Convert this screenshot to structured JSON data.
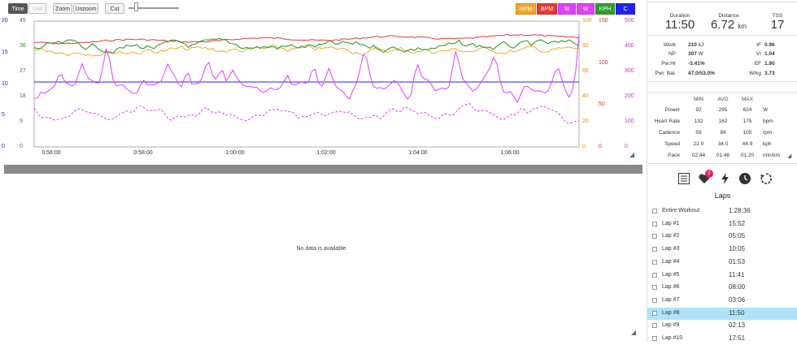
{
  "toolbar": {
    "time": "Time",
    "dist": "Dist",
    "zoom": "Zoom",
    "unzoom": "Unzoom",
    "cut": "Cut"
  },
  "legend": [
    {
      "label": "RPM",
      "color": "#f5a623"
    },
    {
      "label": "BPM",
      "color": "#e53935"
    },
    {
      "label": "W",
      "color": "#e040fb"
    },
    {
      "label": "W",
      "color": "#e040fb"
    },
    {
      "label": "KPH",
      "color": "#2e9e2e"
    },
    {
      "label": "C",
      "color": "#2222ee"
    }
  ],
  "axes": {
    "left_blue": [
      "20",
      "15",
      "10",
      "5",
      "0"
    ],
    "left_green": [
      "45",
      "36",
      "27",
      "18",
      "9",
      "0"
    ],
    "right_orange": [
      "100",
      "80",
      "60",
      "40",
      "20",
      "0"
    ],
    "right_red": [
      "150",
      "100",
      "50",
      "0"
    ],
    "right_magenta": [
      "500",
      "400",
      "300",
      "200",
      "100",
      "0"
    ],
    "x_ticks": [
      "0:56:00",
      "0:58:00",
      "1:00:00",
      "1:02:00",
      "1:04:00",
      "1:06:00"
    ]
  },
  "colors": {
    "cadence": "#f5a623",
    "heart_rate": "#e53935",
    "power": "#e040fb",
    "speed": "#2e9e2e",
    "temperature": "#2222ee"
  },
  "lower_panel": {
    "message": "No data is available"
  },
  "summary": {
    "duration_label": "Duration",
    "duration": "11:50",
    "distance_label": "Distance",
    "distance": "6.72",
    "distance_unit": "km",
    "tss_label": "TSS",
    "tss": "17"
  },
  "metrics": {
    "work_label": "Work",
    "work": "210",
    "work_unit": "kJ",
    "np_label": "NP",
    "np": "307",
    "np_unit": "W",
    "pwhr_label": "Pw:Hr",
    "pwhr": "-3.41%",
    "bal_label": "Pwr. Bal.",
    "bal": "47.0/53.0%",
    "if_label": "IF",
    "if": "0.96",
    "vi_label": "VI",
    "vi": "1.04",
    "ef_label": "EF",
    "ef": "1.90",
    "wkg_label": "W/kg",
    "wkg": "3.73"
  },
  "table": {
    "headers": [
      "MIN",
      "AVG",
      "MAX"
    ],
    "rows": [
      {
        "name": "Power",
        "min": "92",
        "avg": "295",
        "max": "624",
        "unit": "W"
      },
      {
        "name": "Heart Rate",
        "min": "132",
        "avg": "162",
        "max": "175",
        "unit": "bpm"
      },
      {
        "name": "Cadence",
        "min": "59",
        "avg": "84",
        "max": "105",
        "unit": "rpm"
      },
      {
        "name": "Speed",
        "min": "22.0",
        "avg": "34.0",
        "max": "44.9",
        "unit": "kph"
      },
      {
        "name": "Pace",
        "min": "02:44",
        "avg": "01:46",
        "max": "01:20",
        "unit": "min/km"
      }
    ]
  },
  "tabs": {
    "badge": "2"
  },
  "laps_title": "Laps",
  "laps": [
    {
      "name": "Entire Workout",
      "time": "1:28:36"
    },
    {
      "name": "Lap #1",
      "time": "15:52"
    },
    {
      "name": "Lap #2",
      "time": "05:05"
    },
    {
      "name": "Lap #3",
      "time": "10:05"
    },
    {
      "name": "Lap #4",
      "time": "01:53"
    },
    {
      "name": "Lap #5",
      "time": "11:41"
    },
    {
      "name": "Lap #6",
      "time": "08:00"
    },
    {
      "name": "Lap #7",
      "time": "03:06"
    },
    {
      "name": "Lap #8",
      "time": "11:50",
      "selected": true
    },
    {
      "name": "Lap #9",
      "time": "02:13"
    },
    {
      "name": "Lap #10",
      "time": "17:51"
    }
  ]
}
